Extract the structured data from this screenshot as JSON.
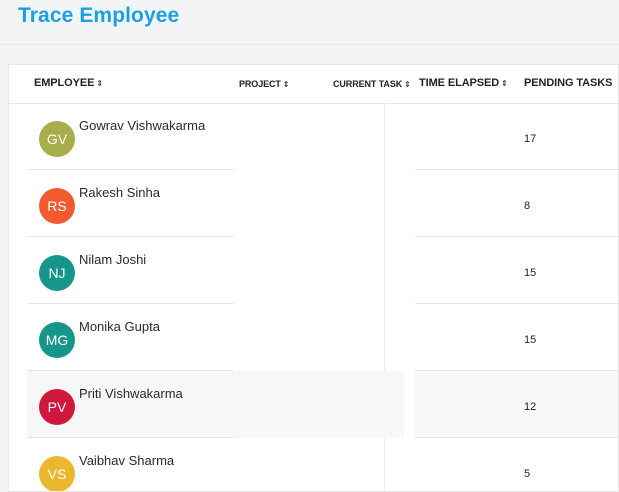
{
  "page_title": "Trace Employee",
  "columns": {
    "employee": "EMPLOYEE",
    "project": "PROJECT",
    "current_task": "CURRENT TASK",
    "time_elapsed": "TIME ELAPSED",
    "pending_tasks": "PENDING TASKS"
  },
  "sort_icon": "sort-arrows-icon",
  "rows": [
    {
      "initials": "GV",
      "name": "Gowrav Vishwakarma",
      "pending": "17",
      "color": "#a8ad4e",
      "project": "",
      "current_task": "",
      "time_elapsed": ""
    },
    {
      "initials": "RS",
      "name": "Rakesh Sinha",
      "pending": "8",
      "color": "#f35a30",
      "project": "",
      "current_task": "",
      "time_elapsed": ""
    },
    {
      "initials": "NJ",
      "name": "Nilam Joshi",
      "pending": "15",
      "color": "#16958b",
      "project": "",
      "current_task": "",
      "time_elapsed": ""
    },
    {
      "initials": "MG",
      "name": "Monika Gupta",
      "pending": "15",
      "color": "#16968a",
      "project": "",
      "current_task": "",
      "time_elapsed": ""
    },
    {
      "initials": "PV",
      "name": "Priti Vishwakarma",
      "pending": "12",
      "color": "#d0173d",
      "project": "",
      "current_task": "",
      "time_elapsed": ""
    },
    {
      "initials": "VS",
      "name": "Vaibhav Sharma",
      "pending": "5",
      "color": "#eab72f",
      "project": "",
      "current_task": "",
      "time_elapsed": ""
    }
  ]
}
